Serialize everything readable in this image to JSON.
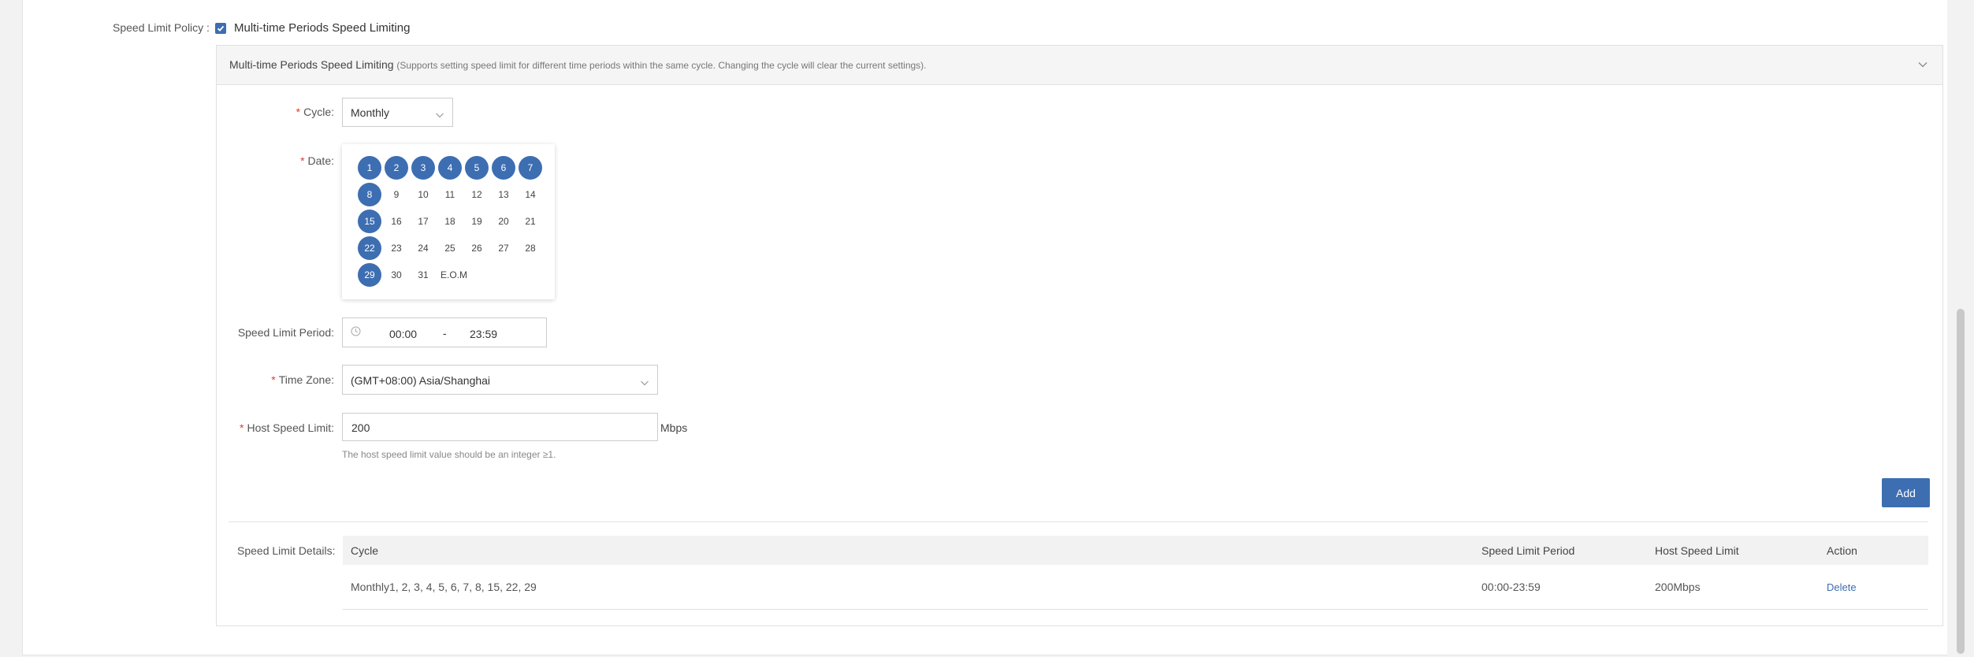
{
  "policy": {
    "label": "Speed Limit Policy :",
    "option_label": "Multi-time Periods Speed Limiting",
    "checked": true
  },
  "panel": {
    "title": "Multi-time Periods Speed Limiting",
    "description": "(Supports setting speed limit for different time periods within the same cycle. Changing the cycle will clear the current settings)."
  },
  "form": {
    "required_mark": "*",
    "cycle": {
      "label": "Cycle:",
      "value": "Monthly"
    },
    "date": {
      "label": "Date:",
      "days": [
        "1",
        "2",
        "3",
        "4",
        "5",
        "6",
        "7",
        "8",
        "9",
        "10",
        "11",
        "12",
        "13",
        "14",
        "15",
        "16",
        "17",
        "18",
        "19",
        "20",
        "21",
        "22",
        "23",
        "24",
        "25",
        "26",
        "27",
        "28",
        "29",
        "30",
        "31",
        "E.O.M"
      ],
      "selected": [
        "1",
        "2",
        "3",
        "4",
        "5",
        "6",
        "7",
        "8",
        "15",
        "22",
        "29"
      ]
    },
    "period": {
      "label": "Speed Limit Period:",
      "start": "00:00",
      "separator": "-",
      "end": "23:59"
    },
    "timezone": {
      "label": "Time Zone:",
      "value": "(GMT+08:00) Asia/Shanghai"
    },
    "host_speed": {
      "label": "Host Speed Limit:",
      "value": "200",
      "unit": "Mbps",
      "hint": "The host speed limit value should be an integer ≥1."
    },
    "add_label": "Add"
  },
  "details": {
    "label": "Speed Limit Details:",
    "columns": [
      "Cycle",
      "Speed Limit Period",
      "Host Speed Limit",
      "Action"
    ],
    "rows": [
      {
        "cycle": "Monthly1, 2, 3, 4, 5, 6, 7, 8, 15, 22, 29",
        "period": "00:00-23:59",
        "limit": "200Mbps",
        "action": "Delete"
      }
    ]
  },
  "colors": {
    "accent": "#3d6eb1",
    "required": "#e03e2d"
  }
}
